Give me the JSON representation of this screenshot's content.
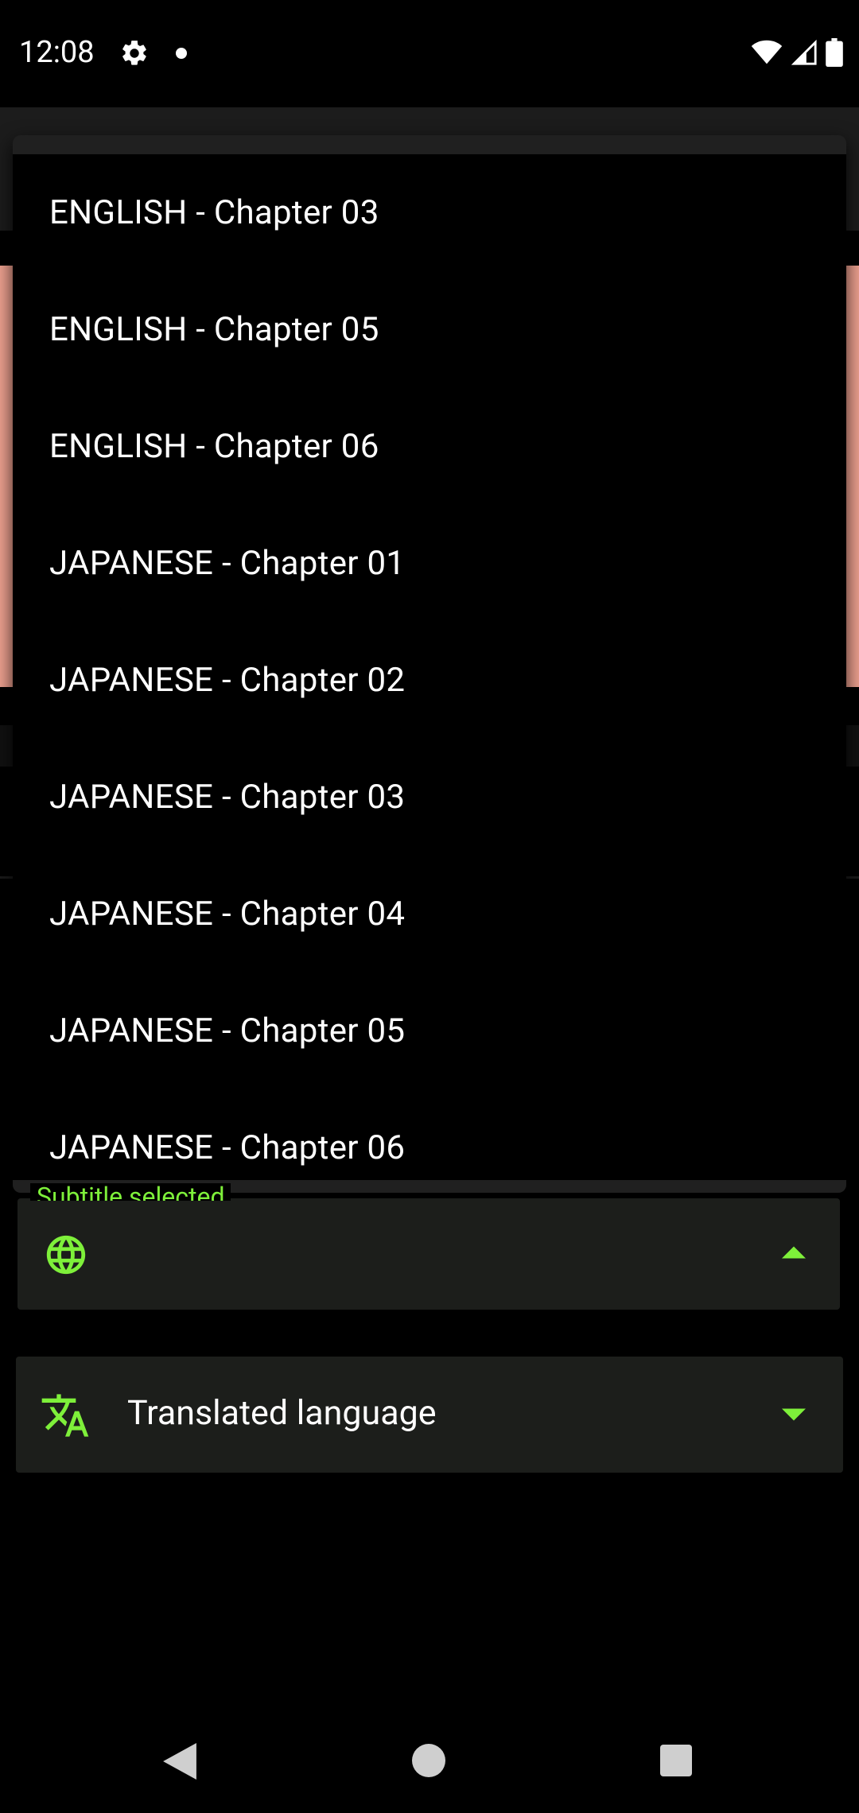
{
  "status_bar": {
    "time": "12:08",
    "icons": [
      "settings-icon",
      "notification-dot-icon",
      "wifi-icon",
      "signal-icon",
      "battery-icon"
    ]
  },
  "dropdown": {
    "items": [
      "ENGLISH - Chapter 03",
      "ENGLISH - Chapter 05",
      "ENGLISH - Chapter 06",
      "JAPANESE - Chapter 01",
      "JAPANESE - Chapter 02",
      "JAPANESE - Chapter 03",
      "JAPANESE - Chapter 04",
      "JAPANESE - Chapter 05",
      "JAPANESE - Chapter 06"
    ]
  },
  "subtitle_field": {
    "label": "Subtitle selected",
    "value": "",
    "icon": "globe-icon",
    "state": "expanded"
  },
  "translate_field": {
    "label": "Translated language",
    "icon": "translate-icon"
  },
  "colors": {
    "accent": "#7ef03a",
    "background": "#000000",
    "field_background": "#1c1e1b",
    "header_image": "#f0a291"
  },
  "nav_bar": {
    "buttons": [
      "back-icon",
      "home-icon",
      "recents-icon"
    ]
  }
}
